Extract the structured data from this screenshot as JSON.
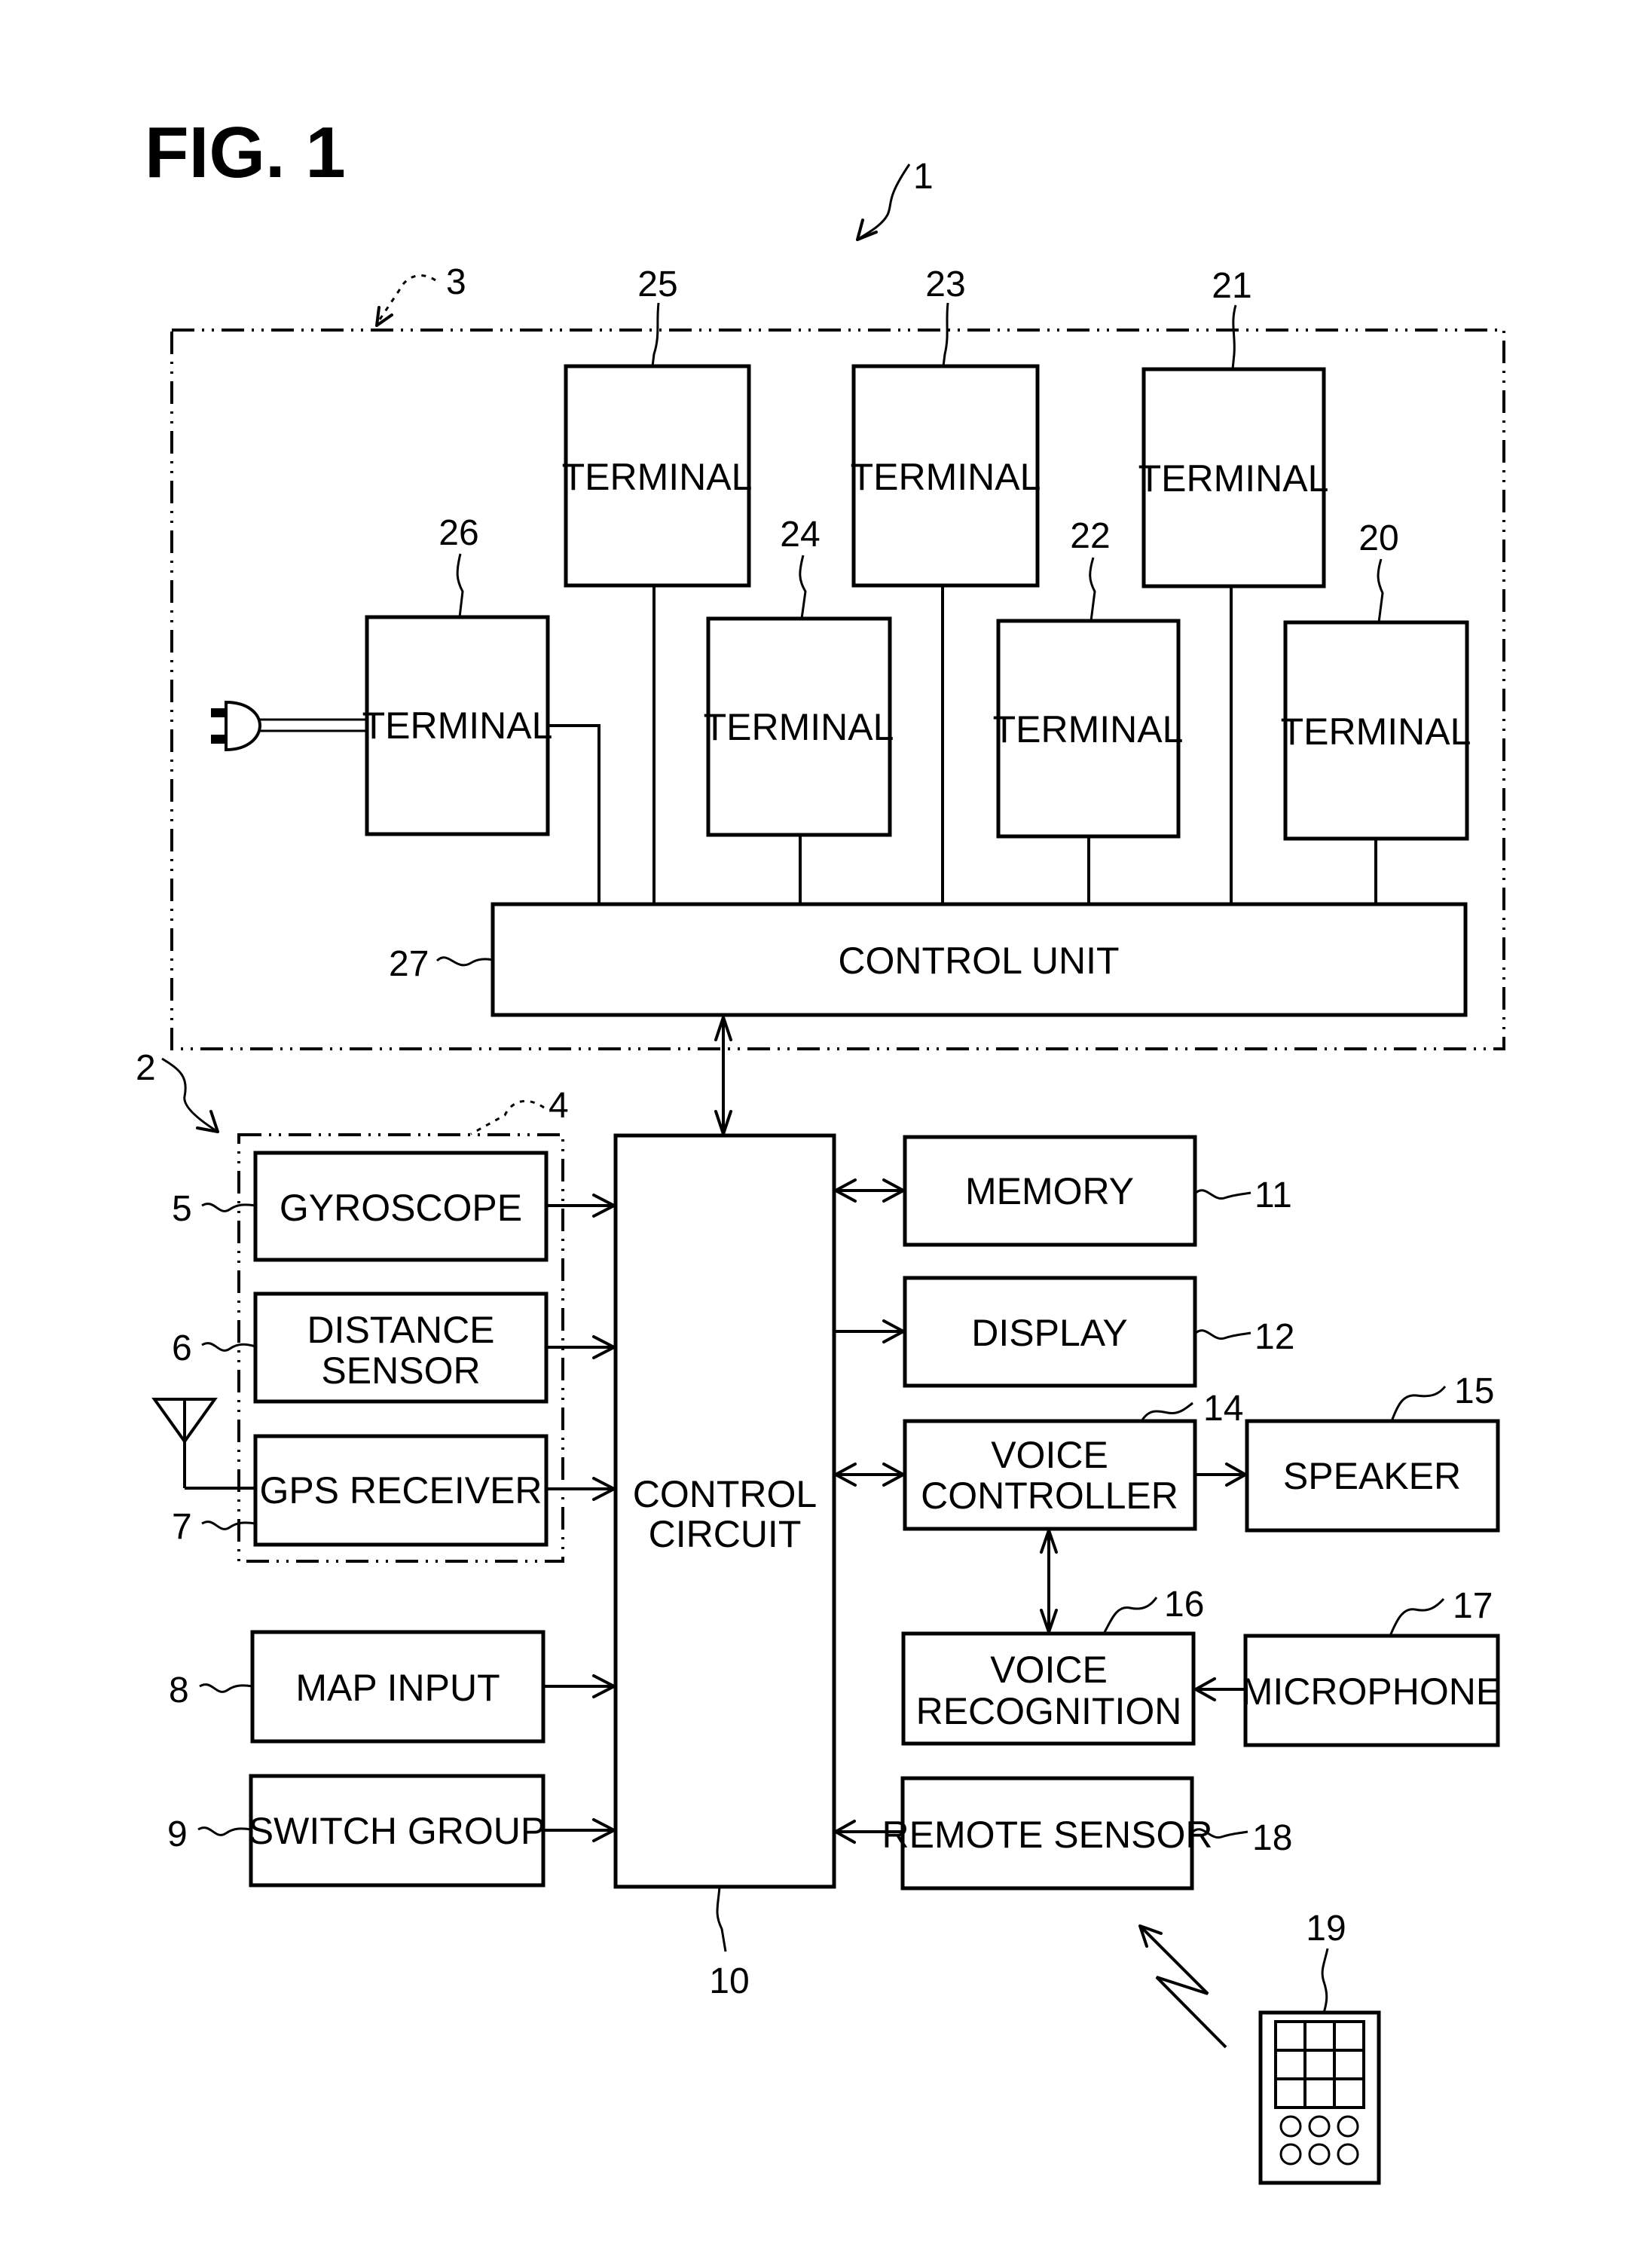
{
  "figure": {
    "title": "FIG. 1",
    "system_ref": "1",
    "navigation_ref": "2",
    "hub_ref": "3",
    "position_group_ref": "4"
  },
  "hub": {
    "terminals": [
      {
        "ref": "20",
        "label": "TERMINAL"
      },
      {
        "ref": "21",
        "label": "TERMINAL"
      },
      {
        "ref": "22",
        "label": "TERMINAL"
      },
      {
        "ref": "23",
        "label": "TERMINAL"
      },
      {
        "ref": "24",
        "label": "TERMINAL"
      },
      {
        "ref": "25",
        "label": "TERMINAL"
      },
      {
        "ref": "26",
        "label": "TERMINAL"
      }
    ],
    "control_unit": {
      "ref": "27",
      "label": "CONTROL UNIT"
    }
  },
  "navigation": {
    "gyroscope": {
      "ref": "5",
      "label": "GYROSCOPE"
    },
    "distance_sensor": {
      "ref": "6",
      "line1": "DISTANCE",
      "line2": "SENSOR"
    },
    "gps_receiver": {
      "ref": "7",
      "label": "GPS RECEIVER"
    },
    "map_input": {
      "ref": "8",
      "label": "MAP INPUT"
    },
    "switch_group": {
      "ref": "9",
      "label": "SWITCH GROUP"
    },
    "control_circuit": {
      "ref": "10",
      "line1": "CONTROL",
      "line2": "CIRCUIT"
    },
    "memory": {
      "ref": "11",
      "label": "MEMORY"
    },
    "display": {
      "ref": "12",
      "label": "DISPLAY"
    },
    "voice_controller": {
      "ref": "14",
      "line1": "VOICE",
      "line2": "CONTROLLER"
    },
    "speaker": {
      "ref": "15",
      "label": "SPEAKER"
    },
    "voice_recognition": {
      "ref": "16",
      "line1": "VOICE",
      "line2": "RECOGNITION"
    },
    "microphone": {
      "ref": "17",
      "label": "MICROPHONE"
    },
    "remote_sensor": {
      "ref": "18",
      "label": "REMOTE SENSOR"
    },
    "remote_controller": {
      "ref": "19"
    }
  }
}
